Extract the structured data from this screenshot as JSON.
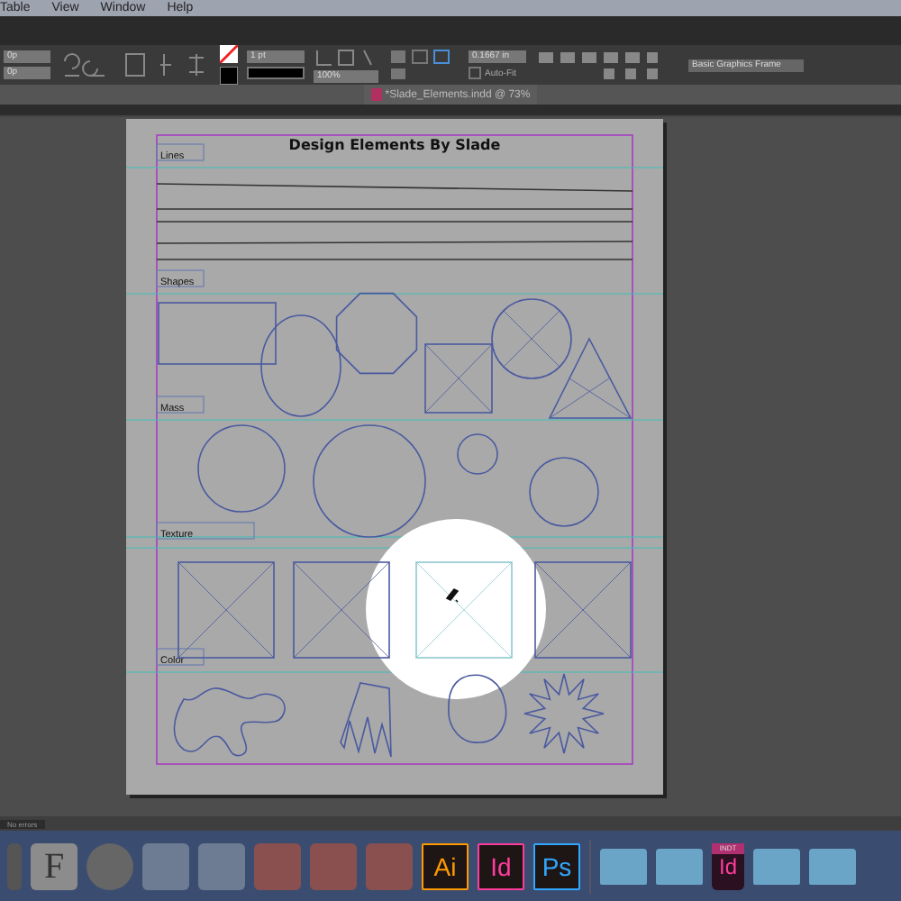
{
  "menu": [
    "Table",
    "View",
    "Window",
    "Help"
  ],
  "control_panel": {
    "x_field": "0p",
    "y_field": "0p",
    "stroke_weight": "1 pt",
    "opacity": "100%",
    "offset": "0.1667 in",
    "auto_fit": {
      "label": "Auto-Fit",
      "checked": false
    },
    "object_style": "Basic Graphics Frame"
  },
  "document_tab": {
    "title": "*Slade_Elements.indd @ 73%"
  },
  "page": {
    "title": "Design Elements By Slade",
    "sections": [
      "Lines",
      "Shapes",
      "Mass",
      "Texture",
      "Color"
    ]
  },
  "status_bar": {
    "preflight": "No errors"
  },
  "dock": {
    "font_app_letter": "F",
    "apps": [
      {
        "label": "Ai",
        "color": "#ff9a00"
      },
      {
        "label": "Id",
        "color": "#ff3c9c"
      },
      {
        "label": "Ps",
        "color": "#31a8ff"
      }
    ],
    "document": {
      "badge": "INDT",
      "label": "Id"
    }
  }
}
